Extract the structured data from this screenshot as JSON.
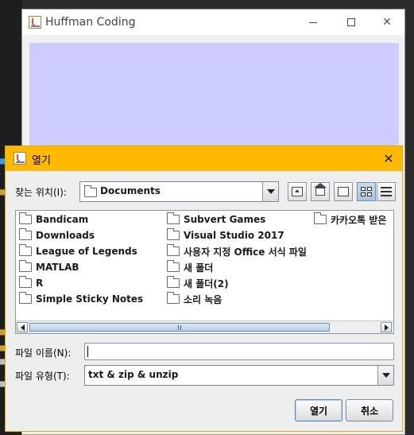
{
  "main_window": {
    "title": "Huffman Coding",
    "controls": {
      "minimize_icon": "minimize-icon",
      "maximize_icon": "maximize-icon",
      "close_glyph": "✕"
    }
  },
  "dialog": {
    "title": "열기",
    "close_glyph": "✕",
    "look_in": {
      "label": "찾는 위치(I):",
      "value": "Documents"
    },
    "toolbar": [
      "up-one-level-icon",
      "home-icon",
      "new-folder-icon",
      "list-view-icon",
      "details-view-icon"
    ],
    "files": [
      "Bandicam",
      "Downloads",
      "League of Legends",
      "MATLAB",
      "R",
      "Simple Sticky Notes",
      "Subvert Games",
      "Visual Studio 2017",
      "사용자 지정 Office 서식 파일",
      "새 폴더",
      "새 폴더(2)",
      "소리 녹음",
      "카카오톡 받은"
    ],
    "file_name": {
      "label": "파일 이름(N):",
      "value": ""
    },
    "file_type": {
      "label": "파일 유형(T):",
      "value": "txt & zip & unzip"
    },
    "buttons": {
      "open": "열기",
      "cancel": "취소"
    }
  },
  "colors": {
    "dialog_title_bar": "#ffb900",
    "canvas": "#ccccff",
    "selection_blue": "#b9cfe5"
  }
}
